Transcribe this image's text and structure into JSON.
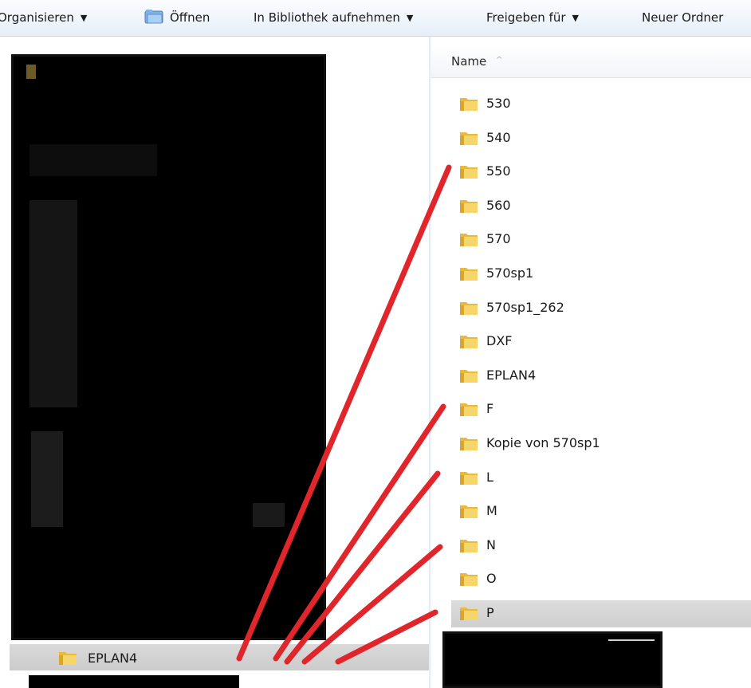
{
  "toolbar": {
    "organize_label": "Organisieren",
    "open_label": "Öffnen",
    "library_label": "In Bibliothek aufnehmen",
    "share_label": "Freigeben für",
    "new_folder_label": "Neuer Ordner",
    "dropdown_glyph": "▼"
  },
  "nav": {
    "selected_item": "EPLAN4"
  },
  "file_list": {
    "column_header": "Name",
    "sort_indicator": "^",
    "items": [
      "530",
      "540",
      "550",
      "560",
      "570",
      "570sp1",
      "570sp1_262",
      "DXF",
      "EPLAN4",
      "F",
      "Kopie von 570sp1",
      "L",
      "M",
      "N",
      "O",
      "P"
    ],
    "selected": "P"
  },
  "colors": {
    "annotation_red": "#e0262a",
    "folder_yellow": "#f2c94c",
    "selection_gray": "#d3d3d3"
  }
}
